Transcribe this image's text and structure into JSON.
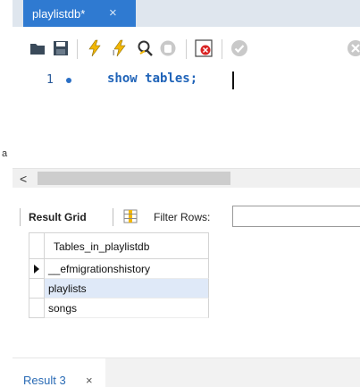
{
  "sidebar": {
    "partial_letter": "a"
  },
  "tab": {
    "label": "playlistdb*",
    "close": "×"
  },
  "toolbar": {
    "icons": [
      "open-folder-icon",
      "save-icon",
      "execute-icon",
      "execute-current-icon",
      "explain-icon",
      "stop-icon",
      "toggle-error-icon",
      "commit-icon",
      "rollback-icon"
    ]
  },
  "editor": {
    "line_number": "1",
    "code": "show tables;"
  },
  "scroll": {
    "left_arrow": "<"
  },
  "result_toolbar": {
    "result_grid_label": "Result Grid",
    "filter_rows_label": "Filter Rows:",
    "filter_value": ""
  },
  "grid": {
    "column_header": "Tables_in_playlistdb",
    "rows": [
      "__efmigrationshistory",
      "playlists",
      "songs"
    ],
    "selected_row_index": 1
  },
  "bottom": {
    "result_tab_label": "Result 3",
    "close": "×"
  },
  "colors": {
    "tab_blue": "#2f7ad1",
    "code_blue": "#1f63b8",
    "selected_row": "#dfe9f8"
  }
}
